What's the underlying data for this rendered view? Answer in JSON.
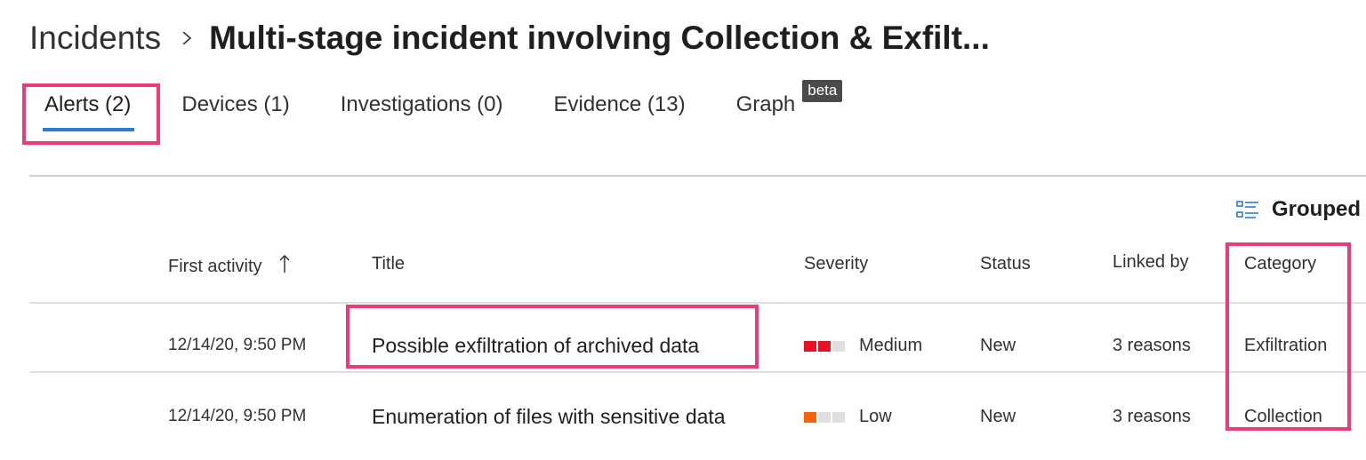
{
  "breadcrumb": {
    "root": "Incidents",
    "title": "Multi-stage incident involving Collection & Exfilt..."
  },
  "tabs": [
    {
      "label": "Alerts (2)",
      "active": true
    },
    {
      "label": "Devices (1)",
      "active": false
    },
    {
      "label": "Investigations (0)",
      "active": false
    },
    {
      "label": "Evidence (13)",
      "active": false
    },
    {
      "label": "Graph",
      "active": false,
      "badge": "beta"
    }
  ],
  "toolbar": {
    "grouped_label": "Grouped",
    "grouped_icon": "grouped-list-icon"
  },
  "table": {
    "headers": {
      "first_activity": "First activity",
      "title": "Title",
      "severity": "Severity",
      "status": "Status",
      "linked_by": "Linked by",
      "category": "Category"
    },
    "sort_icon": "arrow-up-icon",
    "rows": [
      {
        "first_activity": "12/14/20, 9:50 PM",
        "title": "Possible exfiltration of archived data",
        "severity": "Medium",
        "severity_level": 2,
        "severity_color": "#e81123",
        "status": "New",
        "linked_by": "3 reasons",
        "category": "Exfiltration"
      },
      {
        "first_activity": "12/14/20, 9:50 PM",
        "title": "Enumeration of files with sensitive data",
        "severity": "Low",
        "severity_level": 1,
        "severity_color": "#f7630c",
        "status": "New",
        "linked_by": "3 reasons",
        "category": "Collection"
      }
    ]
  },
  "colors": {
    "highlight": "#ee3a77",
    "active_tab_underline": "#2b7cd3",
    "severity_empty": "#e1dfdd"
  }
}
